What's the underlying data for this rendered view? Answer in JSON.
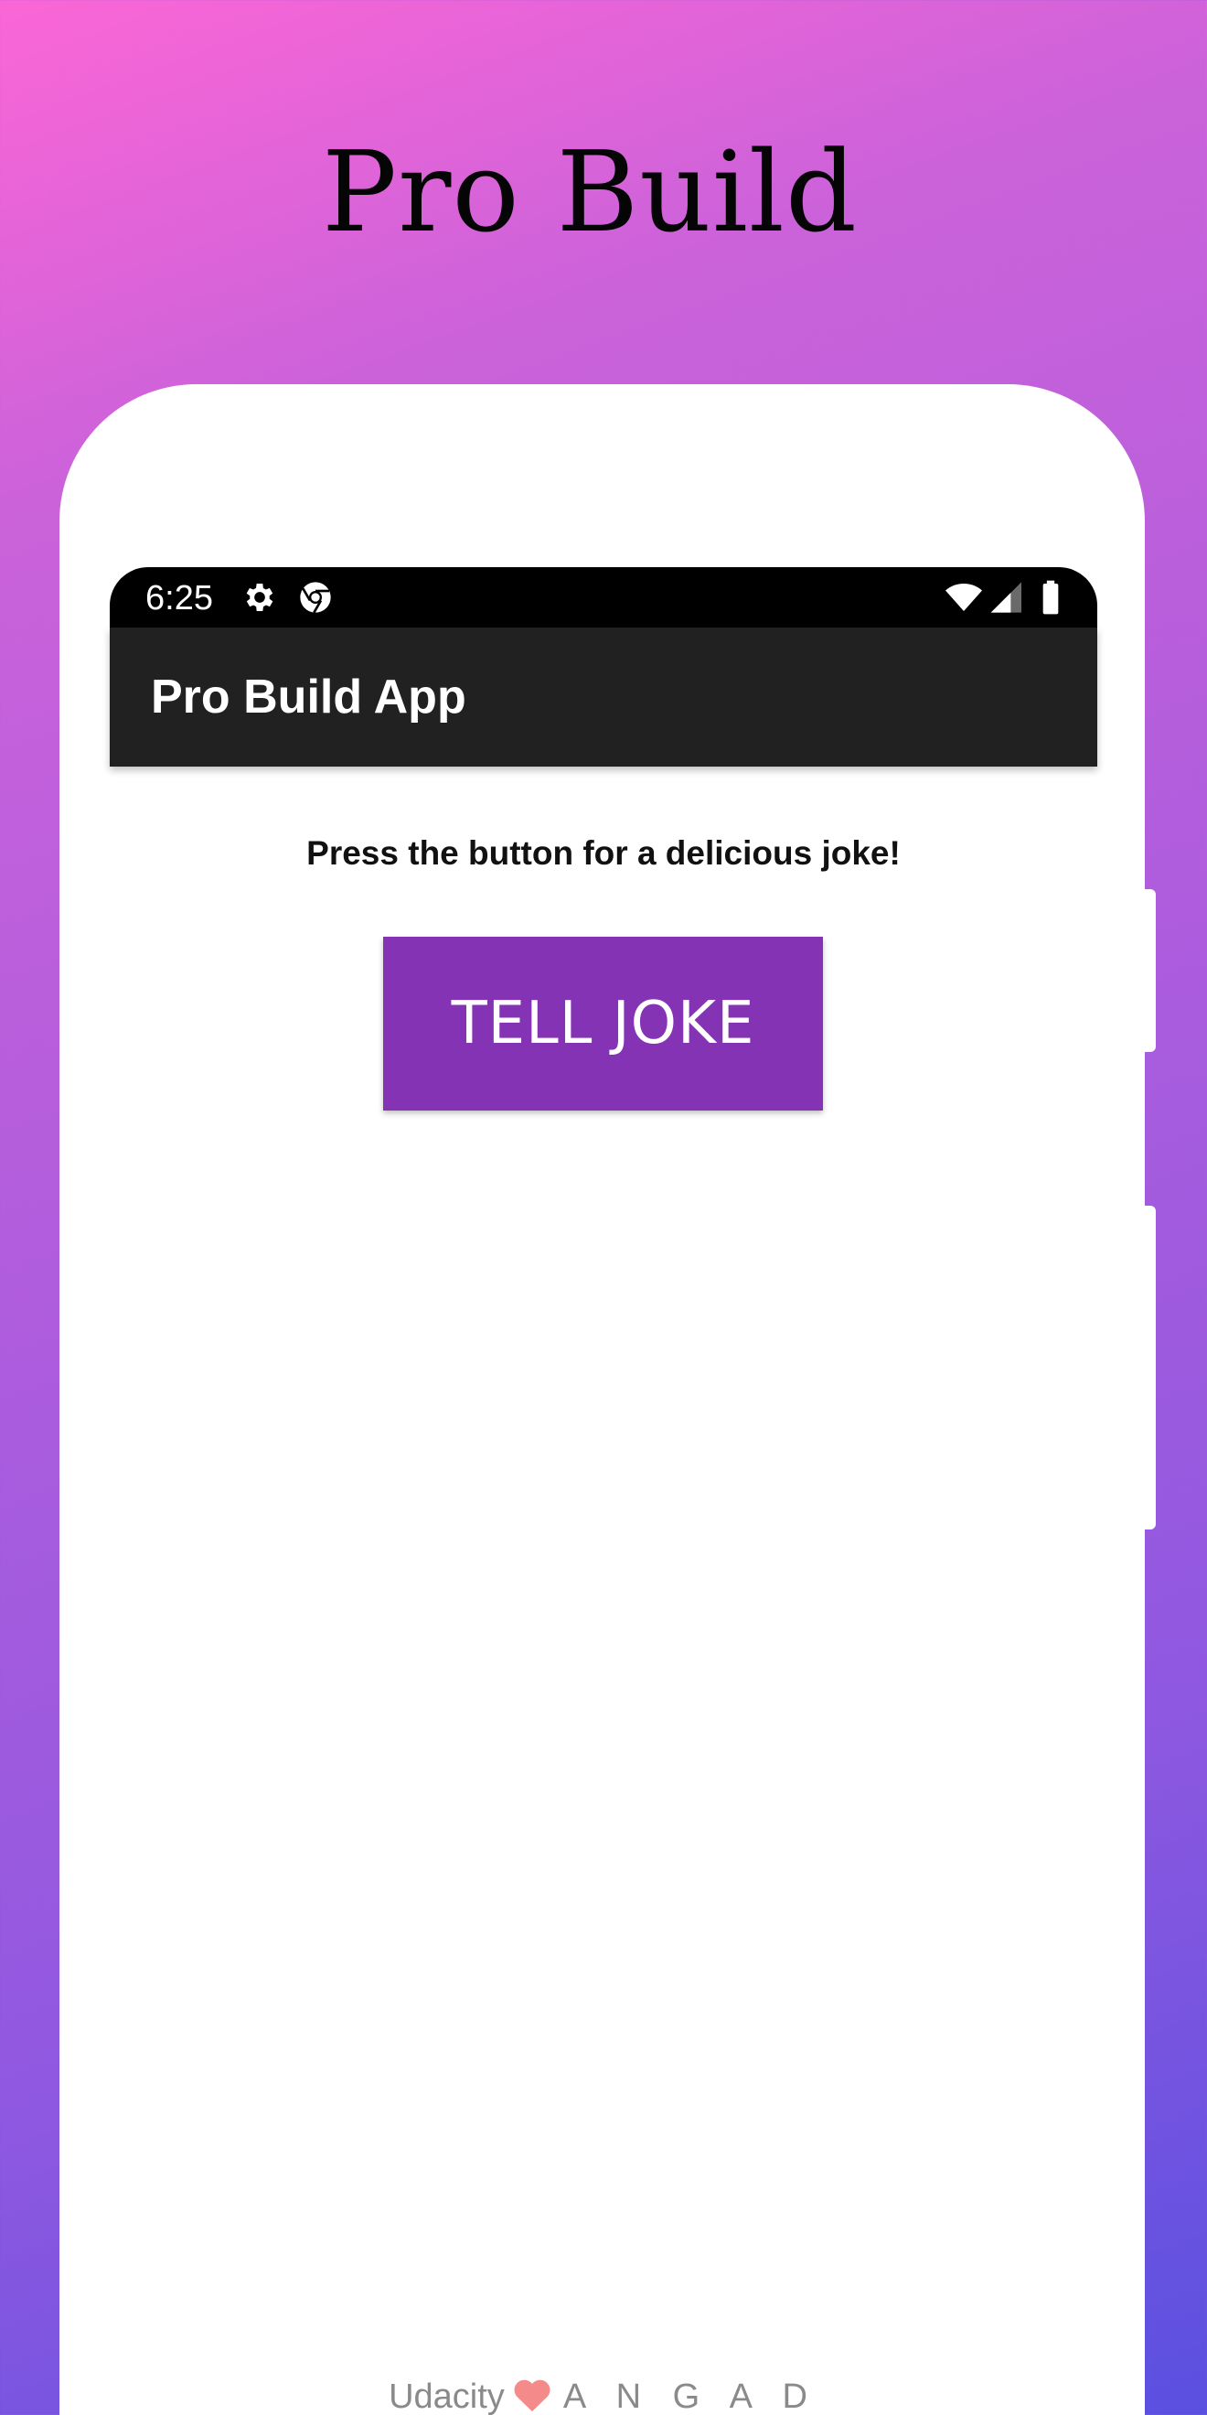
{
  "hero": {
    "title": "Pro Build"
  },
  "status_bar": {
    "time": "6:25",
    "icons": [
      "settings-gear-icon",
      "chrome-icon",
      "wifi-icon",
      "cell-signal-icon",
      "battery-icon"
    ]
  },
  "app_bar": {
    "title": "Pro Build App"
  },
  "main": {
    "prompt": "Press the button for a delicious joke!",
    "button_label": "TELL JOKE"
  },
  "footer": {
    "left": "Udacity",
    "icon": "heart-icon",
    "right": "A N G A D"
  },
  "colors": {
    "gradient_top": "#fb66d6",
    "gradient_bottom": "#5a50e0",
    "app_bar": "#212121",
    "status_bar": "#000000",
    "button": "#8433b5",
    "heart": "#f48a8a"
  }
}
